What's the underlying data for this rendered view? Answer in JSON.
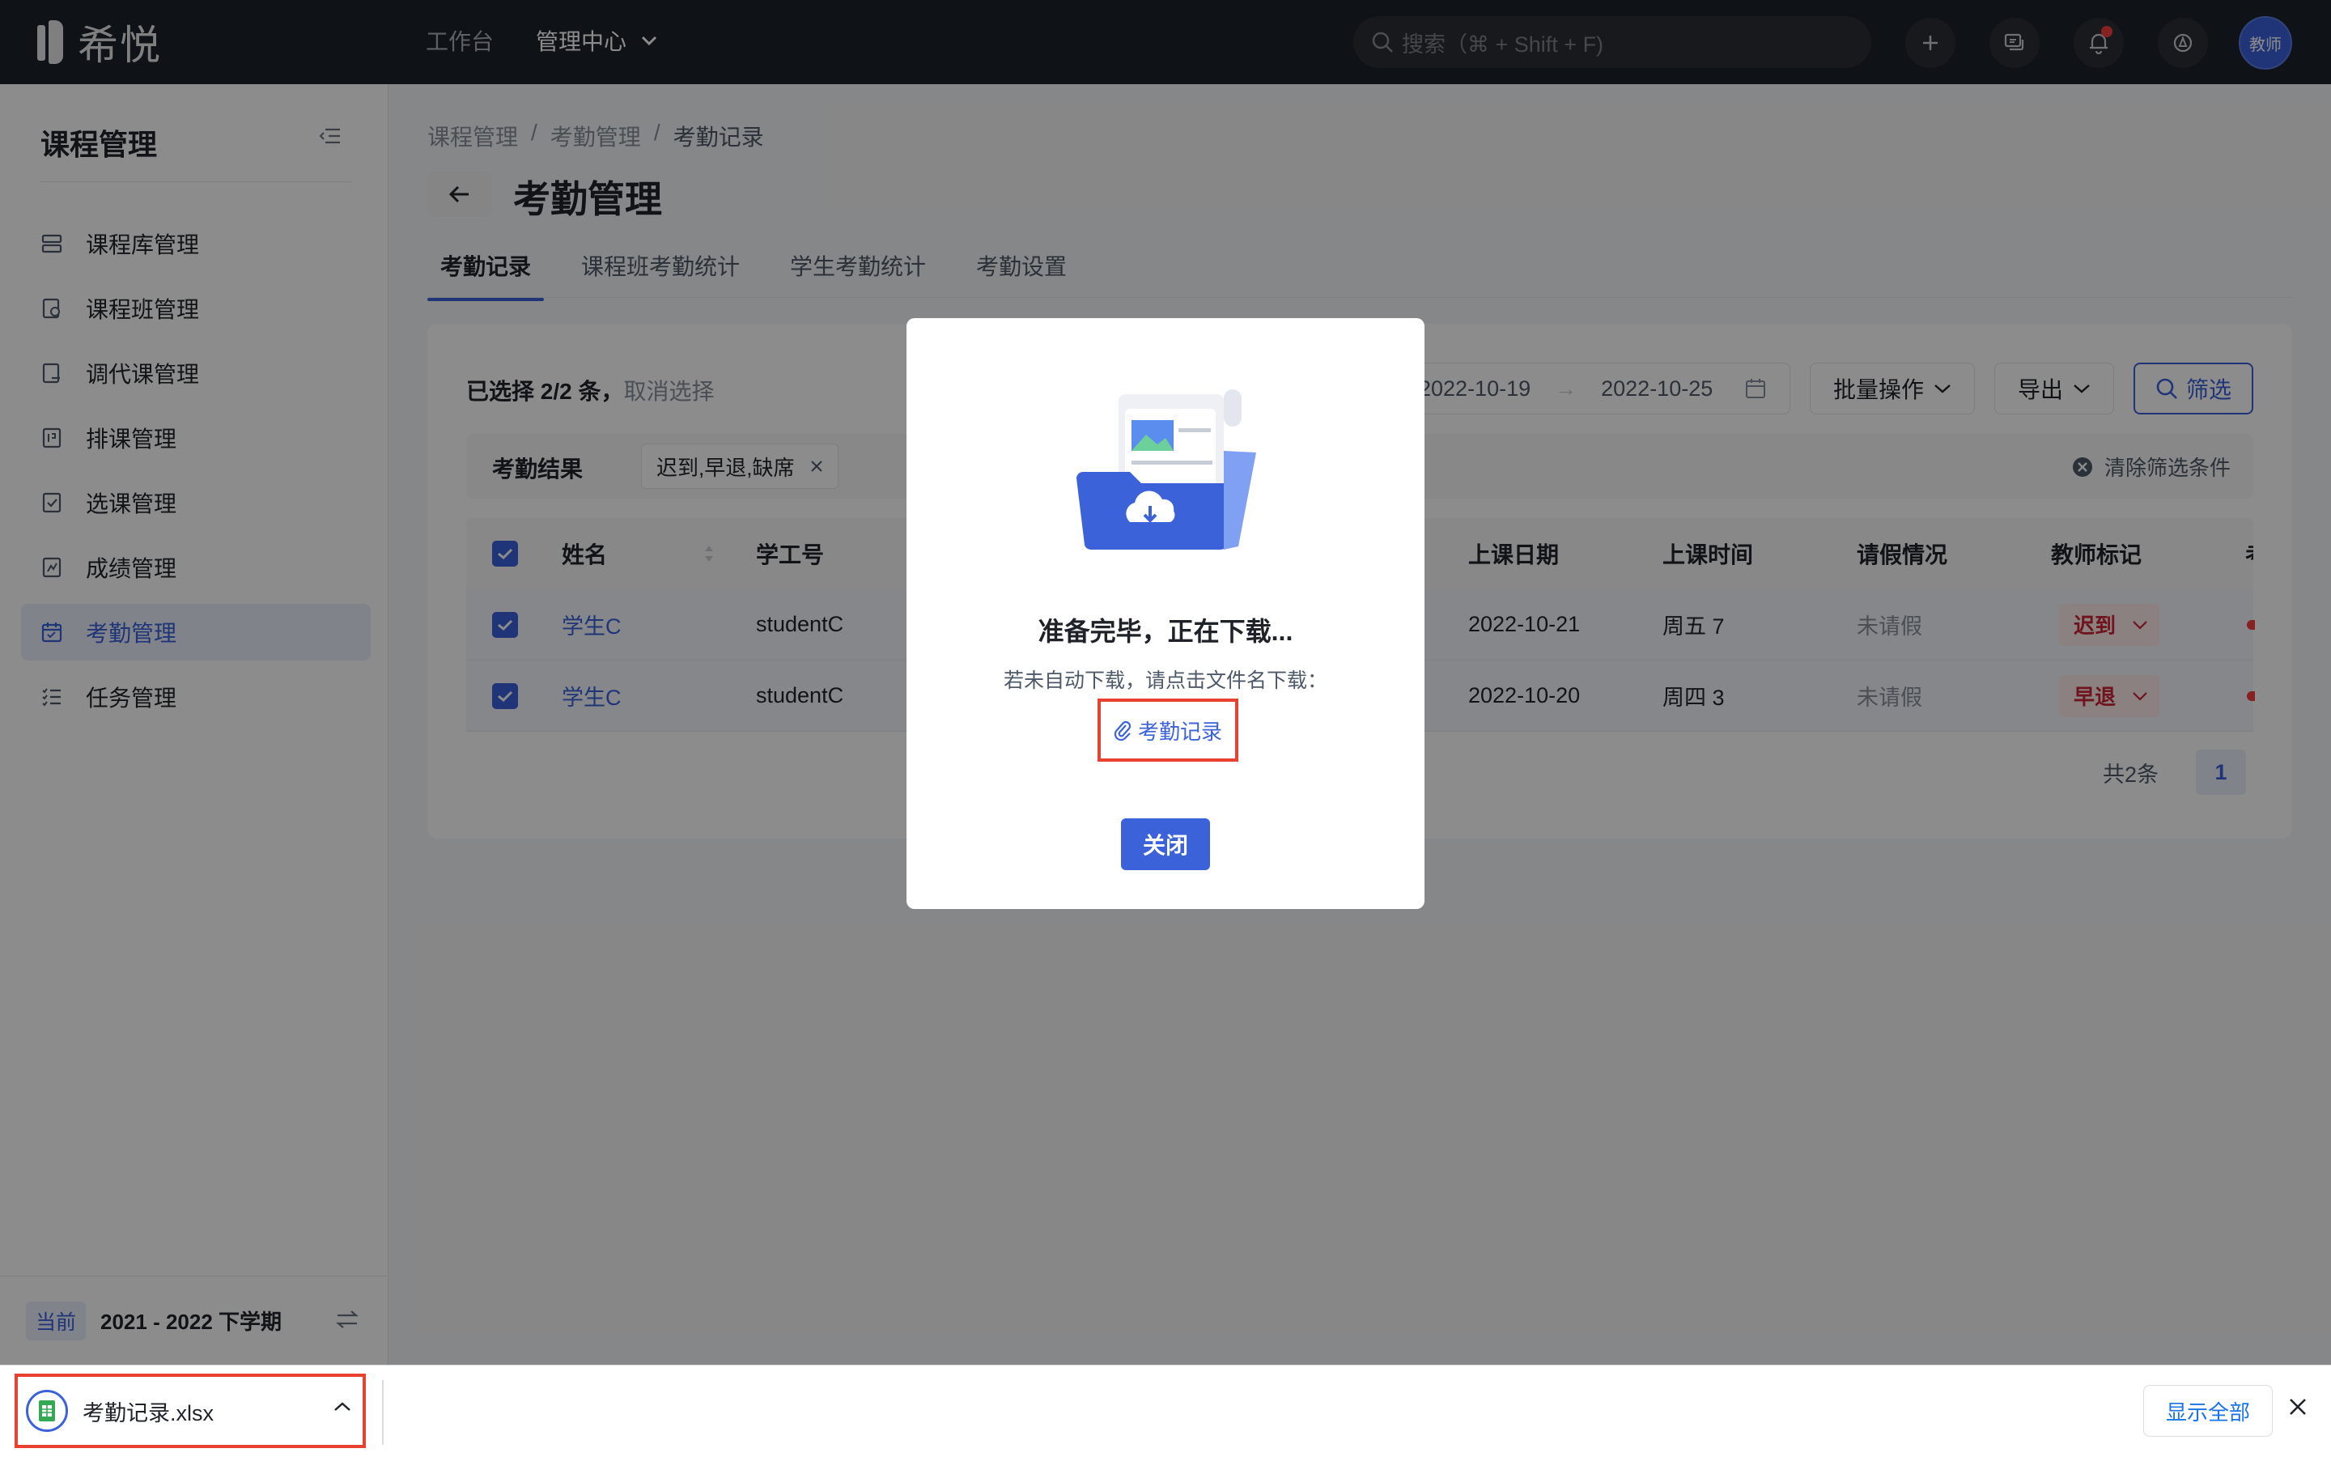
{
  "topbar": {
    "brand": "希悦",
    "nav": [
      {
        "label": "工作台"
      },
      {
        "label": "管理中心"
      }
    ],
    "search_placeholder": "搜索（⌘ + Shift + F)",
    "avatar_label": "教师"
  },
  "sidebar": {
    "title": "课程管理",
    "items": [
      {
        "label": "课程库管理",
        "icon": "course-library-icon"
      },
      {
        "label": "课程班管理",
        "icon": "course-class-icon"
      },
      {
        "label": "调代课管理",
        "icon": "substitute-icon"
      },
      {
        "label": "排课管理",
        "icon": "schedule-icon"
      },
      {
        "label": "选课管理",
        "icon": "elective-icon"
      },
      {
        "label": "成绩管理",
        "icon": "grades-icon"
      },
      {
        "label": "考勤管理",
        "icon": "calendar-icon"
      },
      {
        "label": "任务管理",
        "icon": "task-list-icon"
      }
    ],
    "active_index": 6,
    "term_badge": "当前",
    "term": "2021 - 2022 下学期"
  },
  "breadcrumb": [
    "课程管理",
    "考勤管理",
    "考勤记录"
  ],
  "page_title": "考勤管理",
  "tabs": [
    {
      "label": "考勤记录"
    },
    {
      "label": "课程班考勤统计"
    },
    {
      "label": "学生考勤统计"
    },
    {
      "label": "考勤设置"
    }
  ],
  "toolbar": {
    "selection": "已选择 2/2 条，",
    "cancel_selection": "取消选择",
    "date_start": "2022-10-19",
    "date_sep": "→",
    "date_end": "2022-10-25",
    "batch_label": "批量操作",
    "export_label": "导出",
    "filter_label": "筛选"
  },
  "filter_bar": {
    "label": "考勤结果",
    "tag": "迟到,早退,缺席",
    "clear": "清除筛选条件"
  },
  "table": {
    "columns": {
      "name": "姓名",
      "id": "学工号",
      "date": "上课日期",
      "time": "上课时间",
      "leave": "请假情况",
      "mark": "教师标记",
      "extra": "考"
    },
    "rows": [
      {
        "name": "学生C",
        "id": "studentC",
        "date": "2022-10-21",
        "time": "周五 7",
        "leave": "未请假",
        "mark": "迟到"
      },
      {
        "name": "学生C",
        "id": "studentC",
        "date": "2022-10-20",
        "time": "周四 3",
        "leave": "未请假",
        "mark": "早退"
      }
    ],
    "total": "共2条",
    "page": "1"
  },
  "modal": {
    "title": "准备完毕，正在下载...",
    "subtitle": "若未自动下载，请点击文件名下载：",
    "file_link": "考勤记录",
    "close_label": "关闭"
  },
  "download_bar": {
    "file_name": "考勤记录.xlsx",
    "show_all": "显示全部"
  },
  "colors": {
    "accent": "#3b62d9",
    "topbar": "#1d2129",
    "highlight_border": "#e8412f",
    "danger": "#cb2634"
  }
}
